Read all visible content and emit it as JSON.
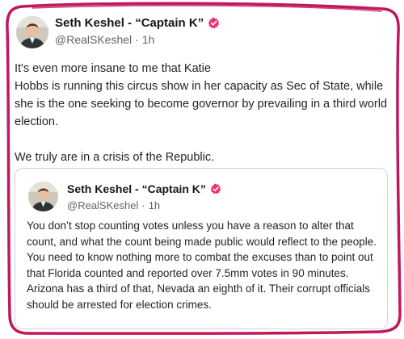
{
  "colors": {
    "annotation": "#c2175b",
    "verified_badge": "#e8356f",
    "text": "#14171a",
    "muted": "#5b6670",
    "card_border": "#cfd4d9"
  },
  "tweet": {
    "author": {
      "display_name": "Seth Keshel - “Captain K”",
      "handle": "@RealSKeshel",
      "separator": "·",
      "time": "1h",
      "verified_icon": "verified-badge-icon"
    },
    "body": {
      "line1": "It's even more insane to me that Katie",
      "line2": "Hobbs is running this circus show in her capacity as Sec of State, while she is the one seeking to become governor by prevailing in a third world election.",
      "line3": "We truly are in a crisis of the Republic."
    }
  },
  "quote": {
    "author": {
      "display_name": "Seth Keshel - “Captain K”",
      "handle": "@RealSKeshel",
      "separator": "·",
      "time": "1h",
      "verified_icon": "verified-badge-icon"
    },
    "body": {
      "para1": "You don’t stop counting votes unless you have a reason to alter that count, and what the count being made public would reflect to the people.",
      "para2": "You need to know nothing more to combat the excuses than to point out that Florida counted and reported over 7.5mm votes in 90 minutes. Arizona has a third of that, Nevada an eighth of it. Their corrupt officials should be arrested for election crimes."
    }
  }
}
